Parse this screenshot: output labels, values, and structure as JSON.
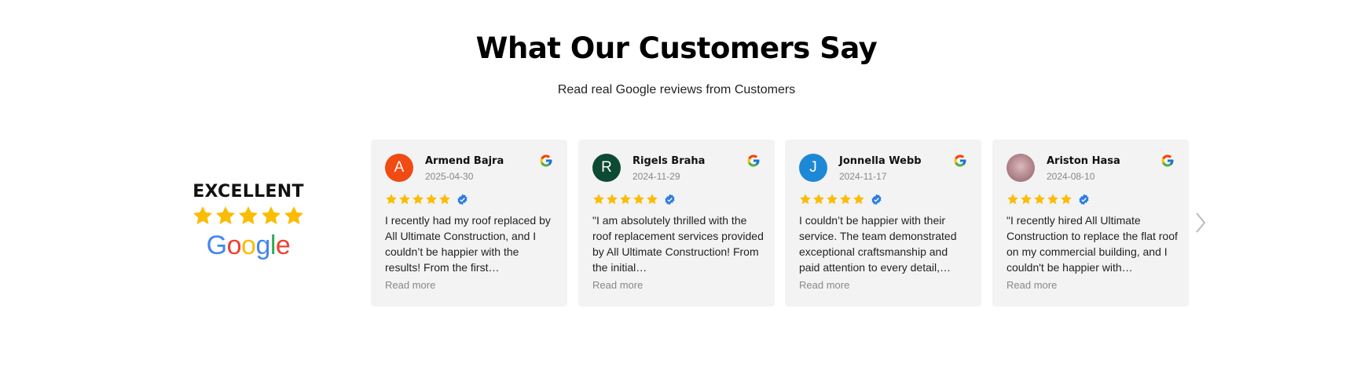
{
  "header": {
    "title": "What Our Customers Say",
    "subtitle": "Read real Google reviews from Customers"
  },
  "summary": {
    "rating_label": "EXCELLENT",
    "stars": 5,
    "logo_text": "Google"
  },
  "colors": {
    "star": "#fbbc04",
    "verified": "#2a7de1",
    "card_background": "#f3f3f3",
    "google_blue": "#4285F4",
    "google_red": "#EA4335",
    "google_yellow": "#FBBC05",
    "google_green": "#34A853"
  },
  "reviews": [
    {
      "name": "Armend Bajra",
      "date": "2025-04-30",
      "initial": "A",
      "avatar_color": "#f14a12",
      "stars": 5,
      "text": "I recently had my roof replaced by All Ultimate Construction, and I couldn’t be happier with the results! From the first…",
      "read_more": "Read more"
    },
    {
      "name": "Rigels Braha",
      "date": "2024-11-29",
      "initial": "R",
      "avatar_color": "#0c4a34",
      "stars": 5,
      "text": "\"I am absolutely thrilled with the roof replacement services provided by All Ultimate Construction! From the initial…",
      "read_more": "Read more"
    },
    {
      "name": "Jonnella Webb",
      "date": "2024-11-17",
      "initial": "J",
      "avatar_color": "#1d88d6",
      "stars": 5,
      "text": "I couldn’t be happier with their service. The team demonstrated exceptional craftsmanship and paid attention to every detail,…",
      "read_more": "Read more"
    },
    {
      "name": "Ariston Hasa",
      "date": "2024-08-10",
      "initial": "",
      "avatar_color": "#b98e94",
      "stars": 5,
      "text": "\"I recently hired All Ultimate Construction to replace the flat roof on my commercial building, and I couldn't be happier with…",
      "read_more": "Read more"
    }
  ],
  "carousel": {
    "next_icon": "chevron-right-icon"
  }
}
